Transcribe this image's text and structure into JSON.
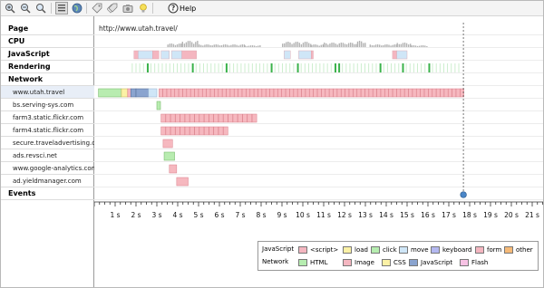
{
  "toolbar": {
    "help_label": "Help",
    "buttons": [
      "zoom-in-icon",
      "zoom-out-icon",
      "zoom-reset-icon",
      "list-view-icon",
      "globe-icon",
      "tag-icon",
      "tag-multiple-icon",
      "camera-icon",
      "lightbulb-icon",
      "help-icon"
    ]
  },
  "rows": {
    "page": "Page",
    "cpu": "CPU",
    "javascript": "JavaScript",
    "rendering": "Rendering",
    "network": "Network",
    "events": "Events",
    "hosts": [
      "www.utah.travel",
      "bs.serving-sys.com",
      "farm3.static.flickr.com",
      "farm4.static.flickr.com",
      "secure.traveladvertising.c",
      "ads.revsci.net",
      "www.google-analytics.com",
      "ad.yieldmanager.com"
    ]
  },
  "page_url": "http://www.utah.travel/",
  "timeline": {
    "ticks": [
      "1 s",
      "2 s",
      "3 s",
      "4 s",
      "5 s",
      "6 s",
      "7 s",
      "8 s",
      "9 s",
      "10 s",
      "11 s",
      "12 s",
      "13 s",
      "14 s",
      "15 s",
      "16 s",
      "17 s",
      "18 s",
      "19 s",
      "20 s",
      "21 s"
    ],
    "marker_time": 17.7
  },
  "legend": {
    "javascript_title": "JavaScript",
    "network_title": "Network",
    "javascript_items": [
      {
        "label": "<script>",
        "color": "#f4b6c0"
      },
      {
        "label": "load",
        "color": "#fbf1a6"
      },
      {
        "label": "click",
        "color": "#b6edb0"
      },
      {
        "label": "move",
        "color": "#cfe6f7"
      },
      {
        "label": "keyboard",
        "color": "#b4b8f0"
      },
      {
        "label": "form",
        "color": "#f4b6c0"
      },
      {
        "label": "other",
        "color": "#f6ba78"
      }
    ],
    "network_items": [
      {
        "label": "HTML",
        "color": "#b6edb0"
      },
      {
        "label": "Image",
        "color": "#f4b6c0"
      },
      {
        "label": "CSS",
        "color": "#fbf1a6"
      },
      {
        "label": "JavaScript",
        "color": "#8aa4cf"
      },
      {
        "label": "Flash",
        "color": "#f7c2e4"
      }
    ]
  },
  "colors": {
    "image": "#f6b8bf",
    "image_border": "#d97e89",
    "html": "#b8ecb0",
    "css": "#fbf1a6",
    "javascript_net": "#8aa4cf",
    "js_block": "#f4b6c0",
    "js_light": "#cfe6f7",
    "render_green": "#3ab24a",
    "cpu": "#b3b3b3",
    "marker": "#555555"
  }
}
